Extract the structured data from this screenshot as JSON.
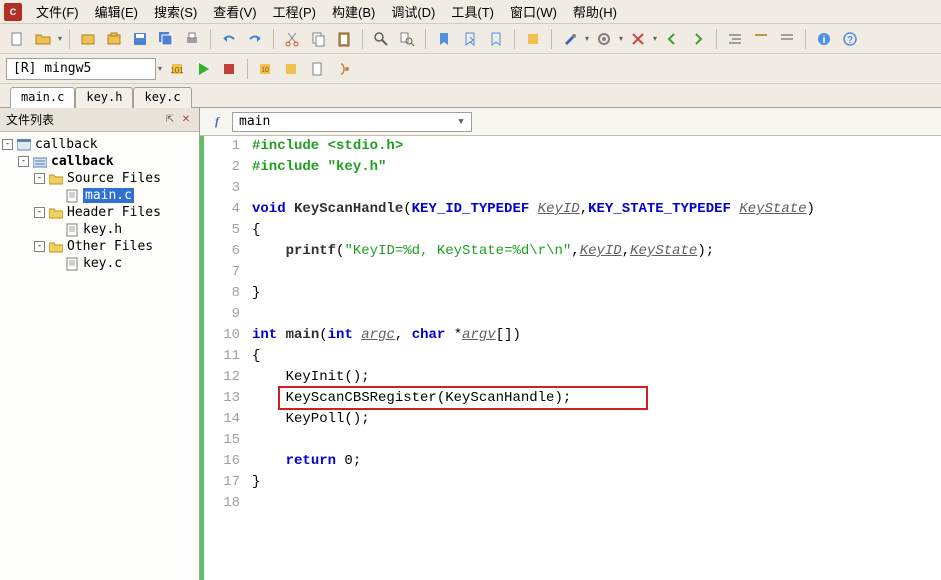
{
  "menubar": {
    "items": [
      "文件(F)",
      "编辑(E)",
      "搜索(S)",
      "查看(V)",
      "工程(P)",
      "构建(B)",
      "调试(D)",
      "工具(T)",
      "窗口(W)",
      "帮助(H)"
    ]
  },
  "compile_target": "[R] mingw5",
  "file_tabs": [
    {
      "name": "main.c",
      "active": true
    },
    {
      "name": "key.h",
      "active": false
    },
    {
      "name": "key.c",
      "active": false
    }
  ],
  "sidebar": {
    "title": "文件列表",
    "tree": {
      "workspace": "callback",
      "project": "callback",
      "folders": [
        {
          "name": "Source Files",
          "files": [
            "main.c"
          ],
          "selected_file": "main.c"
        },
        {
          "name": "Header Files",
          "files": [
            "key.h"
          ]
        },
        {
          "name": "Other Files",
          "files": [
            "key.c"
          ]
        }
      ]
    }
  },
  "func_nav": {
    "icon_label": "f",
    "combo": "main"
  },
  "code": {
    "lines": [
      {
        "n": 1,
        "html": "<span class='c-include'>#include &lt;stdio.h&gt;</span>"
      },
      {
        "n": 2,
        "html": "<span class='c-include'>#include \"key.h\"</span>"
      },
      {
        "n": 3,
        "html": ""
      },
      {
        "n": 4,
        "html": "<span class='c-keyword'>void</span> <span class='c-func'>KeyScanHandle</span>(<span class='c-type'>KEY_ID_TYPEDEF</span> <span class='c-param'>KeyID</span>,<span class='c-type'>KEY_STATE_TYPEDEF</span> <span class='c-param'>KeyState</span>)"
      },
      {
        "n": 5,
        "html": "{"
      },
      {
        "n": 6,
        "html": "    <span class='c-func'>printf</span>(<span class='c-string'>\"KeyID=%d, KeyState=%d\\r\\n\"</span>,<span class='c-param'>KeyID</span>,<span class='c-param'>KeyState</span>);"
      },
      {
        "n": 7,
        "html": ""
      },
      {
        "n": 8,
        "html": "}"
      },
      {
        "n": 9,
        "html": ""
      },
      {
        "n": 10,
        "html": "<span class='c-keyword'>int</span> <span class='c-func'>main</span>(<span class='c-keyword'>int</span> <span class='c-param'>argc</span>, <span class='c-keyword'>char</span> *<span class='c-param'>argv</span>[])"
      },
      {
        "n": 11,
        "html": "{"
      },
      {
        "n": 12,
        "html": "    KeyInit();"
      },
      {
        "n": 13,
        "html": "    KeyScanCBSRegister(KeyScanHandle);",
        "boxed": true
      },
      {
        "n": 14,
        "html": "    KeyPoll();"
      },
      {
        "n": 15,
        "html": ""
      },
      {
        "n": 16,
        "html": "    <span class='c-keyword'>return</span> 0;"
      },
      {
        "n": 17,
        "html": "}"
      },
      {
        "n": 18,
        "html": ""
      }
    ]
  }
}
